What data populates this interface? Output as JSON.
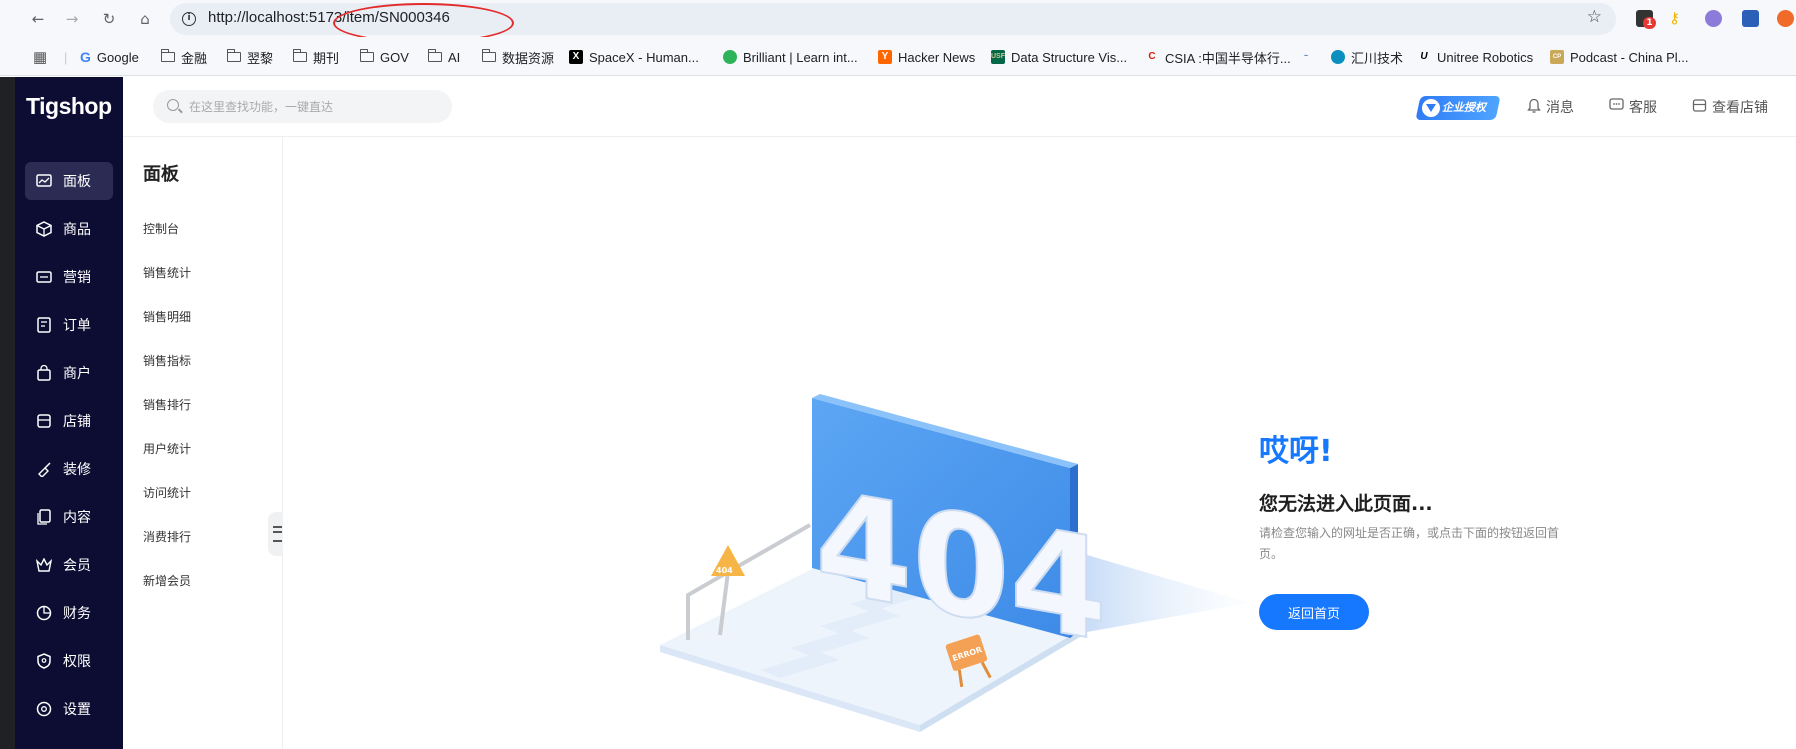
{
  "browser": {
    "url": "http://localhost:5173/item/SN000346",
    "icons": [
      "back-icon",
      "forward-icon",
      "reload-icon",
      "home-icon",
      "site-info-icon",
      "bookmark-star-icon"
    ],
    "notification_count": "1"
  },
  "bookmarks": [
    {
      "label": "Google",
      "icon": "google-icon"
    },
    {
      "label": "金融",
      "icon": "folder-icon"
    },
    {
      "label": "翌黎",
      "icon": "folder-icon"
    },
    {
      "label": "期刊",
      "icon": "folder-icon"
    },
    {
      "label": "GOV",
      "icon": "folder-icon"
    },
    {
      "label": "AI",
      "icon": "folder-icon"
    },
    {
      "label": "数据资源",
      "icon": "folder-icon"
    },
    {
      "label": "SpaceX - Human...",
      "icon": "spacex-icon"
    },
    {
      "label": "Brilliant | Learn int...",
      "icon": "brilliant-icon"
    },
    {
      "label": "Hacker News",
      "icon": "hackernews-icon"
    },
    {
      "label": "Data Structure Vis...",
      "icon": "usf-icon"
    },
    {
      "label": "CSIA :中国半导体行...",
      "icon": "csia-icon"
    },
    {
      "label": "",
      "icon": "site-icon"
    },
    {
      "label": "汇川技术",
      "icon": "inovance-icon"
    },
    {
      "label": "Unitree Robotics",
      "icon": "unitree-icon"
    },
    {
      "label": "Podcast - China Pl...",
      "icon": "podcast-icon"
    }
  ],
  "app": {
    "logo": "Tigshop",
    "search_placeholder": "在这里查找功能，一键直达",
    "enterprise_badge": "企业授权",
    "header_links": [
      {
        "label": "消息",
        "icon": "bell-icon"
      },
      {
        "label": "客服",
        "icon": "chat-icon"
      },
      {
        "label": "查看店铺",
        "icon": "store-icon"
      }
    ],
    "nav": [
      {
        "label": "面板",
        "icon": "chart-icon",
        "active": true
      },
      {
        "label": "商品",
        "icon": "box-icon"
      },
      {
        "label": "营销",
        "icon": "ticket-icon"
      },
      {
        "label": "订单",
        "icon": "order-icon"
      },
      {
        "label": "商户",
        "icon": "bag-icon"
      },
      {
        "label": "店铺",
        "icon": "shop-icon"
      },
      {
        "label": "装修",
        "icon": "brush-icon"
      },
      {
        "label": "内容",
        "icon": "content-icon"
      },
      {
        "label": "会员",
        "icon": "crown-icon"
      },
      {
        "label": "财务",
        "icon": "pie-icon"
      },
      {
        "label": "权限",
        "icon": "shield-icon"
      },
      {
        "label": "设置",
        "icon": "settings-icon"
      }
    ],
    "submenu_title": "面板",
    "submenu": [
      "控制台",
      "销售统计",
      "销售明细",
      "销售指标",
      "销售排行",
      "用户统计",
      "访问统计",
      "消费排行",
      "新增会员"
    ]
  },
  "error_page": {
    "oops": "哎呀!",
    "headline": "您无法进入此页面...",
    "description": "请检查您输入的网址是否正确，或点击下面的按钮返回首页。",
    "button": "返回首页",
    "illustration_text": "404",
    "sign_small": "404",
    "sign_error": "ERROR"
  },
  "colors": {
    "accent": "#1677ff",
    "sidebar": "#0d0d33",
    "annotation": "#e22b2b"
  }
}
